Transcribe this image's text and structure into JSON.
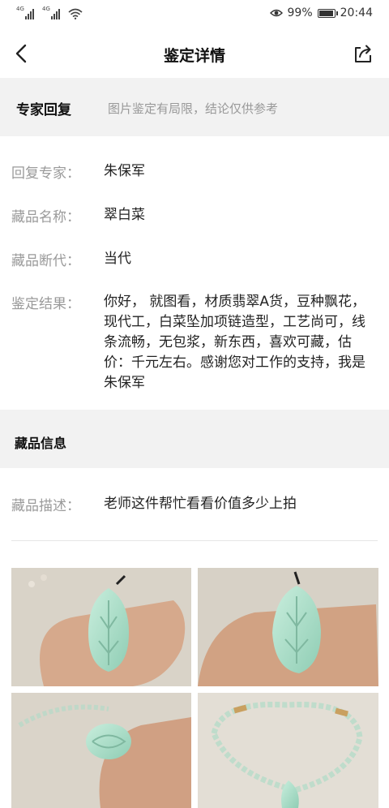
{
  "status_bar": {
    "signal1_label": "4G",
    "signal2_label": "4G",
    "battery_percent": "99%",
    "battery_level": 0.99,
    "time": "20:44"
  },
  "nav": {
    "title": "鉴定详情"
  },
  "expert_reply": {
    "heading": "专家回复",
    "note": "图片鉴定有局限，结论仅供参考",
    "fields": [
      {
        "label": "回复专家：",
        "value": "朱保军"
      },
      {
        "label": "藏品名称：",
        "value": "翠白菜"
      },
      {
        "label": "藏品断代：",
        "value": "当代"
      },
      {
        "label": "鉴定结果：",
        "value": "你好， 就图看，材质翡翠A货，豆种飘花，现代工，白菜坠加项链造型，工艺尚可，线条流畅，无包浆，新东西，喜欢可藏，估价：千元左右。感谢您对工作的支持，我是朱保军"
      }
    ]
  },
  "collection_info": {
    "heading": "藏品信息",
    "description_label": "藏品描述：",
    "description_value": "老师这件帮忙看看价值多少上拍"
  },
  "photos": [
    {
      "name": "photo-1"
    },
    {
      "name": "photo-2"
    },
    {
      "name": "photo-3"
    },
    {
      "name": "photo-4"
    }
  ],
  "colors": {
    "band_bg": "#f2f2f2",
    "label_gray": "#9a9a9a",
    "jade": "#a8dcc8"
  }
}
